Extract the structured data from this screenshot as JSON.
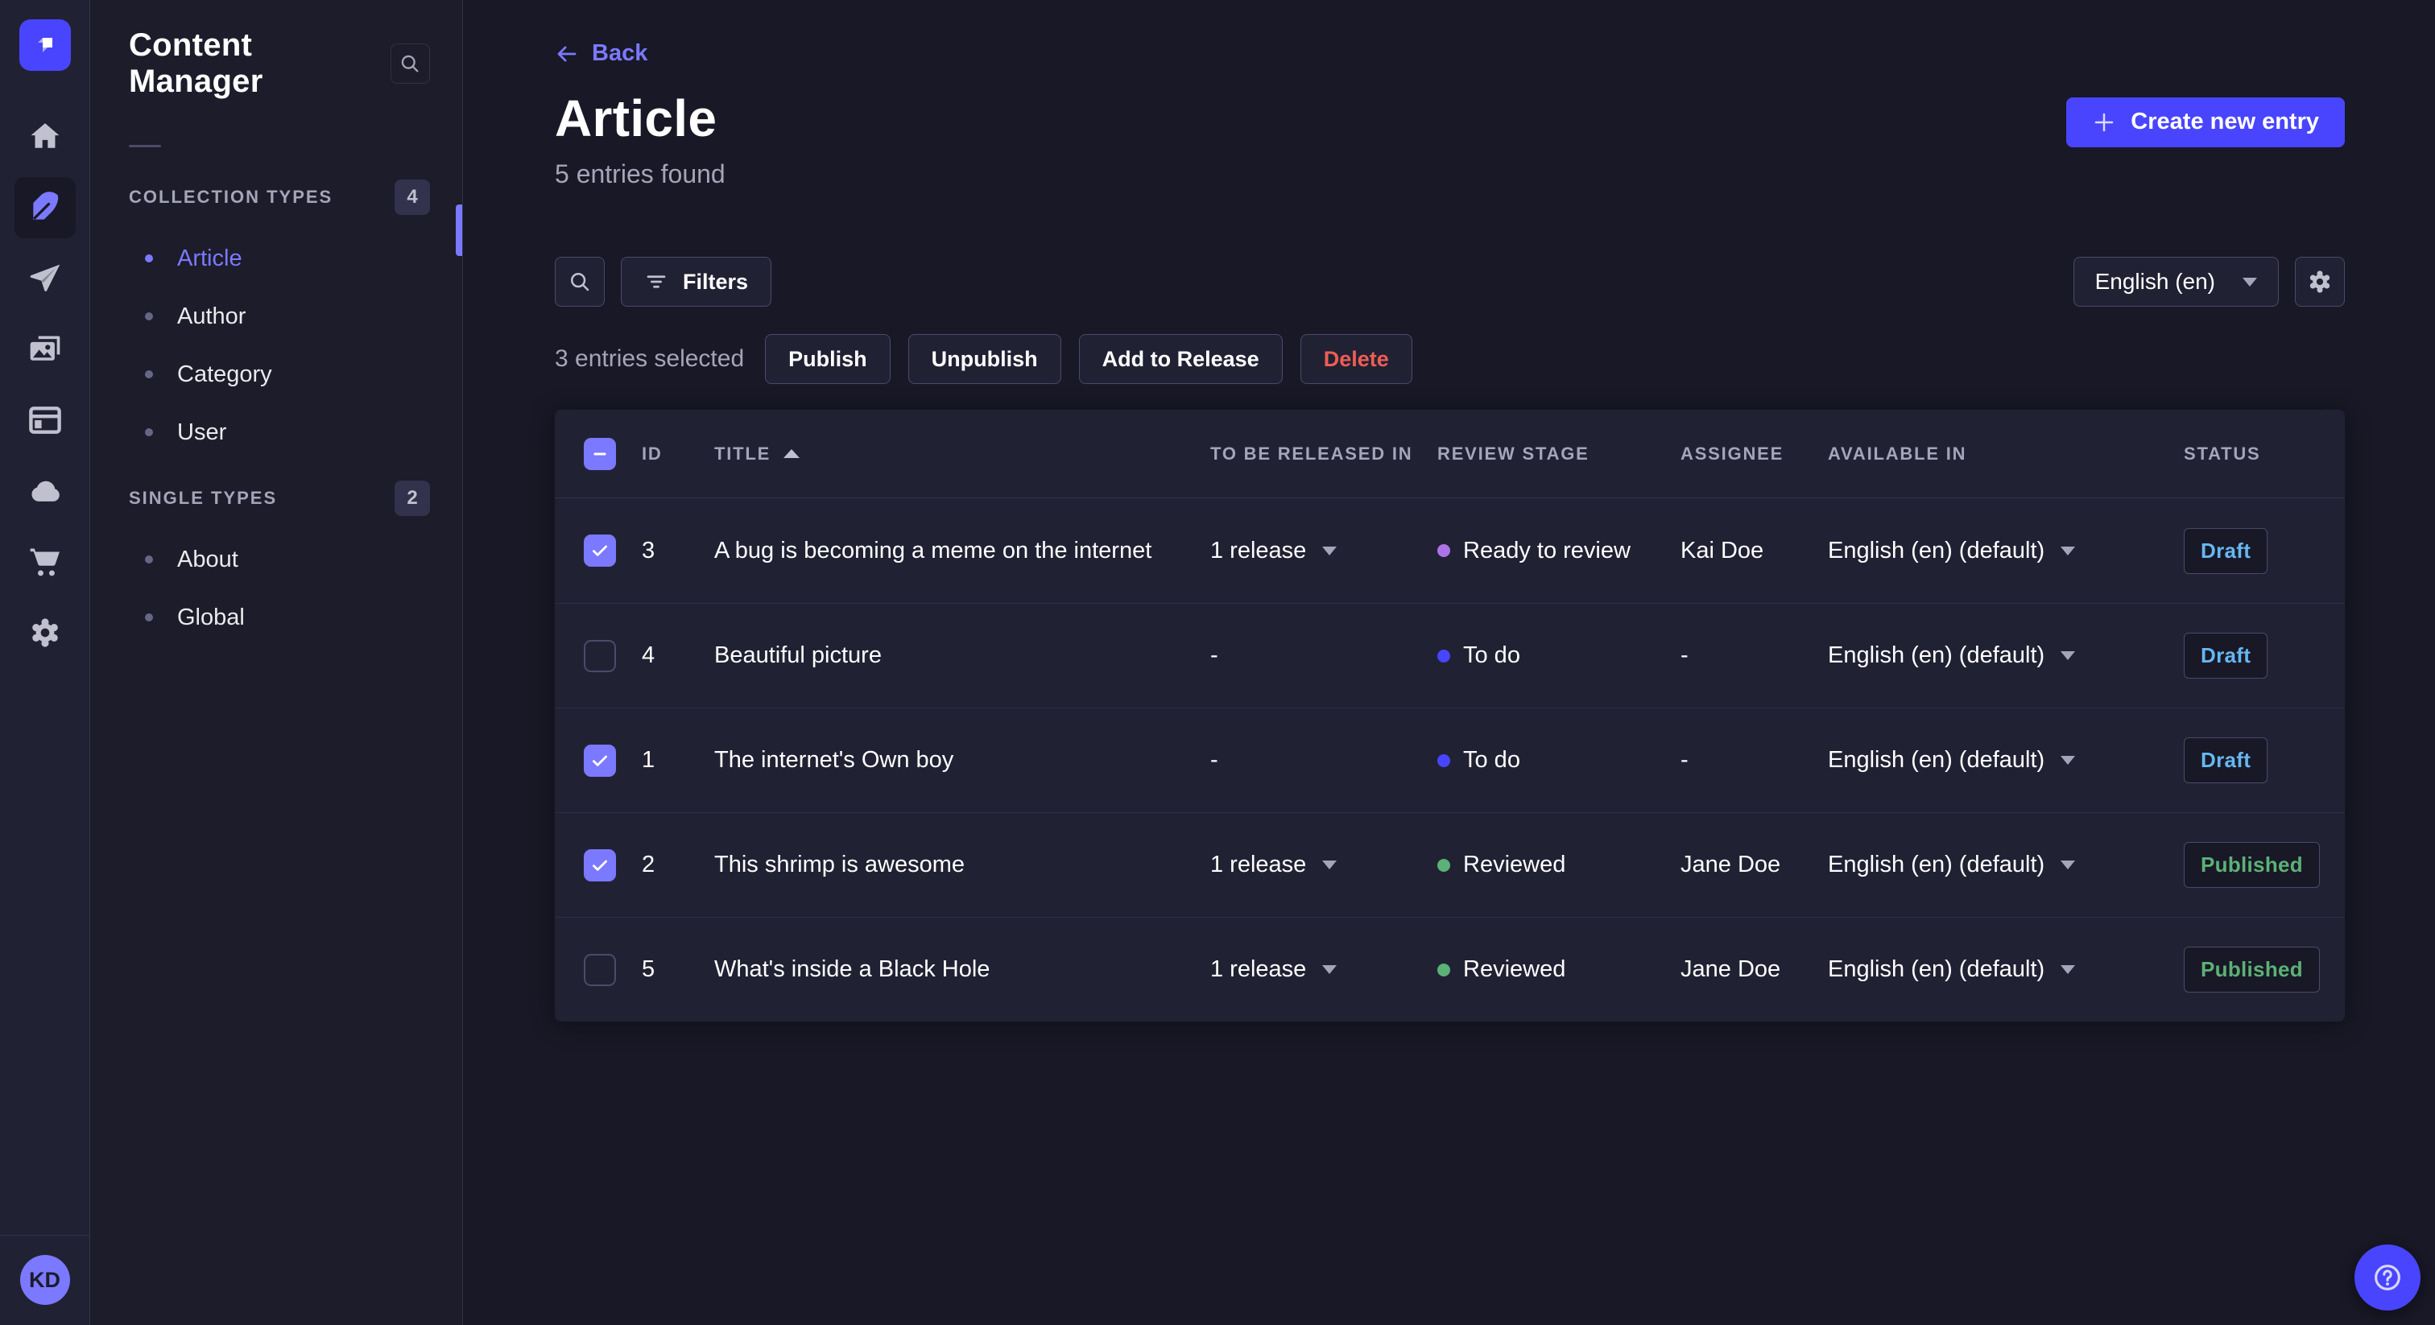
{
  "colors": {
    "primary": "#4945ff",
    "primary_light": "#7b79ff",
    "draft": "#66b7f1",
    "published": "#5cb176",
    "danger": "#ee5e52",
    "stage_ready": "#ac73e6",
    "stage_todo": "#4945ff",
    "stage_reviewed": "#5cb176"
  },
  "rail": {
    "logo_icon": "strapi-logo",
    "items": [
      {
        "icon": "home",
        "active": false
      },
      {
        "icon": "feather",
        "active": true
      },
      {
        "icon": "paper-plane",
        "active": false
      },
      {
        "icon": "media",
        "active": false
      },
      {
        "icon": "layout",
        "active": false
      },
      {
        "icon": "cloud",
        "active": false
      },
      {
        "icon": "cart",
        "active": false
      },
      {
        "icon": "gear",
        "active": false
      }
    ],
    "user_initials": "KD"
  },
  "subnav": {
    "title": "Content Manager",
    "search_icon": "magnifying-glass",
    "sections": [
      {
        "label": "COLLECTION TYPES",
        "count": "4",
        "items": [
          {
            "label": "Article",
            "active": true
          },
          {
            "label": "Author",
            "active": false
          },
          {
            "label": "Category",
            "active": false
          },
          {
            "label": "User",
            "active": false
          }
        ]
      },
      {
        "label": "SINGLE TYPES",
        "count": "2",
        "items": [
          {
            "label": "About",
            "active": false
          },
          {
            "label": "Global",
            "active": false
          }
        ]
      }
    ]
  },
  "header": {
    "back_label": "Back",
    "back_icon": "arrow-left",
    "title": "Article",
    "subtitle": "5 entries found",
    "create_label": "Create new entry",
    "create_icon": "plus"
  },
  "toolbar": {
    "search_icon": "magnifying-glass",
    "filters_label": "Filters",
    "filters_icon": "filter-lines",
    "locale_value": "English (en)",
    "settings_icon": "gear"
  },
  "selection": {
    "summary": "3 entries selected",
    "actions": [
      "Publish",
      "Unpublish",
      "Add to Release",
      "Delete"
    ]
  },
  "table": {
    "headers": {
      "id": "ID",
      "title": "TITLE",
      "release": "TO BE RELEASED IN",
      "stage": "REVIEW STAGE",
      "assignee": "ASSIGNEE",
      "available": "AVAILABLE IN",
      "status": "STATUS"
    },
    "sort": {
      "column": "TITLE",
      "direction": "asc"
    },
    "header_checkbox": "indeterminate",
    "rows": [
      {
        "selected": true,
        "id": "3",
        "title": "A bug is becoming a meme on the internet",
        "release": "1 release",
        "stage": "Ready to review",
        "stage_key": "ready",
        "assignee": "Kai Doe",
        "available": "English (en) (default)",
        "status": "Draft",
        "status_key": "draft"
      },
      {
        "selected": false,
        "id": "4",
        "title": "Beautiful picture",
        "release": "-",
        "stage": "To do",
        "stage_key": "todo",
        "assignee": "-",
        "available": "English (en) (default)",
        "status": "Draft",
        "status_key": "draft"
      },
      {
        "selected": true,
        "id": "1",
        "title": "The internet's Own boy",
        "release": "-",
        "stage": "To do",
        "stage_key": "todo",
        "assignee": "-",
        "available": "English (en) (default)",
        "status": "Draft",
        "status_key": "draft"
      },
      {
        "selected": true,
        "id": "2",
        "title": "This shrimp is awesome",
        "release": "1 release",
        "stage": "Reviewed",
        "stage_key": "reviewed",
        "assignee": "Jane Doe",
        "available": "English (en) (default)",
        "status": "Published",
        "status_key": "published"
      },
      {
        "selected": false,
        "id": "5",
        "title": "What's inside a Black Hole",
        "release": "1 release",
        "stage": "Reviewed",
        "stage_key": "reviewed",
        "assignee": "Jane Doe",
        "available": "English (en) (default)",
        "status": "Published",
        "status_key": "published"
      }
    ]
  },
  "help": {
    "icon": "question-mark-circle"
  }
}
